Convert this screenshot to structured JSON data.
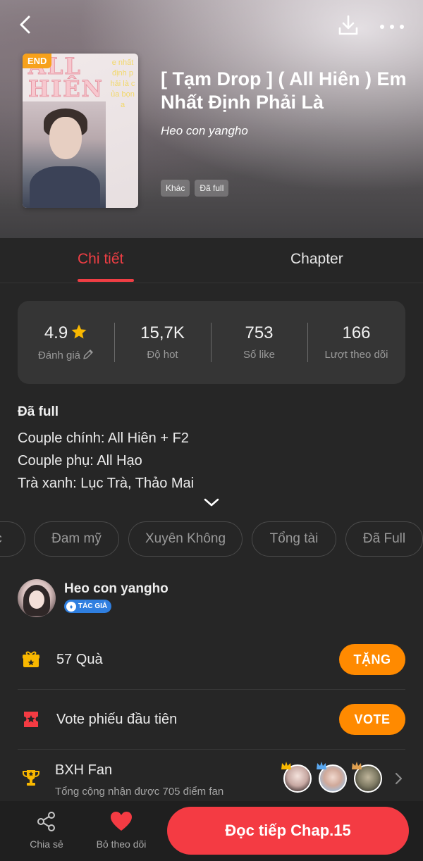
{
  "header": {
    "end_badge": "END",
    "cover_title": "ALL HIÊN",
    "cover_side_text": "e nhất định phải là của bọn a",
    "title": "[ Tạm Drop ] ( All Hiên ) Em Nhất Định Phải Là",
    "author": "Heo con yangho",
    "tags": [
      "Khác",
      "Đã full"
    ]
  },
  "tabs": [
    {
      "label": "Chi tiết",
      "active": true
    },
    {
      "label": "Chapter",
      "active": false
    }
  ],
  "stats": [
    {
      "value": "4.9",
      "label": "Đánh giá"
    },
    {
      "value": "15,7K",
      "label": "Độ hot"
    },
    {
      "value": "753",
      "label": "Số like"
    },
    {
      "value": "166",
      "label": "Lượt theo dõi"
    }
  ],
  "description": {
    "heading": "Đã full",
    "lines": [
      "Couple chính: All Hiên + F2",
      "Couple phụ: All Hạo",
      "Trà xanh: Lục Trà, Thảo Mai"
    ]
  },
  "genres": [
    "c",
    "Đam mỹ",
    "Xuyên Không",
    "Tổng tài",
    "Đã Full"
  ],
  "author_section": {
    "name": "Heo con yangho",
    "badge": "TÁC GIẢ"
  },
  "gifts": {
    "label": "57 Quà",
    "button": "TẶNG"
  },
  "vote": {
    "label": "Vote phiếu đầu tiên",
    "button": "VOTE"
  },
  "fan_rank": {
    "label": "BXH Fan",
    "subtitle": "Tổng cộng nhận được 705 điểm fan"
  },
  "bottom_bar": {
    "share": "Chia sẻ",
    "unfollow": "Bỏ theo dõi",
    "read": "Đọc tiếp Chap.15"
  },
  "colors": {
    "accent": "#ef3e44",
    "button_orange": "#ff8a00",
    "star": "#f9b800",
    "background": "#262626"
  }
}
